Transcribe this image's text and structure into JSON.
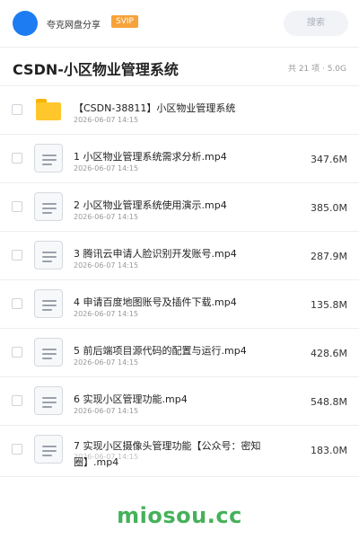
{
  "header": {
    "user_name": "夸克网盘分享",
    "vip_badge": "SVIP",
    "search_placeholder": "搜索",
    "accent_color": "#1e7cf3",
    "vip_color": "#f7a23a"
  },
  "folder": {
    "title": "CSDN-小区物业管理系统",
    "meta": "共 21 项 · 5.0G"
  },
  "files": [
    {
      "name": "【CSDN-38811】小区物业管理系统",
      "date": "2026-06-07 14:15",
      "size": "",
      "icon": "folder-icon"
    },
    {
      "name": "1 小区物业管理系统需求分析.mp4",
      "date": "2026-06-07 14:15",
      "size": "347.6M",
      "icon": "document-icon"
    },
    {
      "name": "2 小区物业管理系统使用演示.mp4",
      "date": "2026-06-07 14:15",
      "size": "385.0M",
      "icon": "document-icon"
    },
    {
      "name": "3 腾讯云申请人脸识别开发账号.mp4",
      "date": "2026-06-07 14:15",
      "size": "287.9M",
      "icon": "document-icon"
    },
    {
      "name": "4 申请百度地图账号及插件下载.mp4",
      "date": "2026-06-07 14:15",
      "size": "135.8M",
      "icon": "document-icon"
    },
    {
      "name": "5 前后端项目源代码的配置与运行.mp4",
      "date": "2026-06-07 14:15",
      "size": "428.6M",
      "icon": "document-icon"
    },
    {
      "name": "6 实现小区管理功能.mp4",
      "date": "2026-06-07 14:15",
      "size": "548.8M",
      "icon": "document-icon"
    },
    {
      "name": "7 实现小区摄像头管理功能【公众号：密知圈】.mp4",
      "date": "2026-06-07 14:15",
      "size": "183.0M",
      "icon": "document-icon"
    }
  ],
  "watermark": "miosou.cc"
}
